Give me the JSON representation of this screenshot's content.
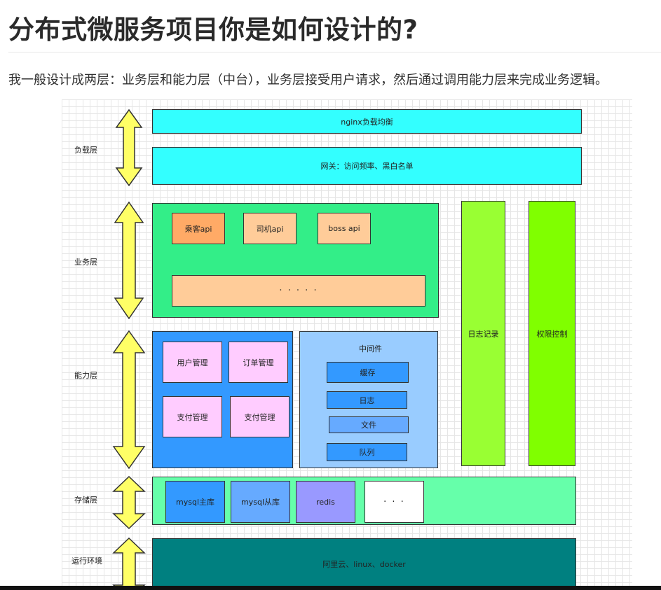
{
  "title": "分布式微服务项目你是如何设计的?",
  "paragraph": "我一般设计成两层：业务层和能力层（中台），业务层接受用户请求，然后通过调用能力层来完成业务逻辑。",
  "diagram": {
    "layers": {
      "load": "负载层",
      "business": "业务层",
      "capability": "能力层",
      "storage": "存储层",
      "runtime": "运行环境"
    },
    "load_layer": {
      "nginx": "nginx负载均衡",
      "gateway": "网关：访问频率、黑白名单"
    },
    "business_layer": {
      "passenger_api": "乘客api",
      "driver_api": "司机api",
      "boss_api": "boss api",
      "more": "· · · · ·"
    },
    "capability_layer": {
      "user_mgmt": "用户管理",
      "order_mgmt": "订单管理",
      "pay_mgmt_1": "支付管理",
      "pay_mgmt_2": "支付管理",
      "middleware_title": "中间件",
      "cache": "缓存",
      "log": "日志",
      "file": "文件",
      "queue": "队列"
    },
    "side": {
      "logging": "日志记录",
      "permission": "权限控制"
    },
    "storage_layer": {
      "mysql_master": "mysql主库",
      "mysql_slave": "mysql从库",
      "redis": "redis",
      "more": "· · ·"
    },
    "runtime_layer": {
      "env": "阿里云、linux、docker"
    },
    "colors": {
      "cyan": "#33ffff",
      "green": "#33ee88",
      "orange_dark": "#ffaa66",
      "orange_light": "#ffcc99",
      "blue": "#3399ff",
      "light_blue": "#99ccff",
      "pink": "#ffccff",
      "lime": "#99ff33",
      "lime_bright": "#80ff00",
      "mint": "#66ffaa",
      "purple": "#9999ff",
      "teal": "#008080",
      "arrow_yellow": "#ffff66"
    }
  }
}
